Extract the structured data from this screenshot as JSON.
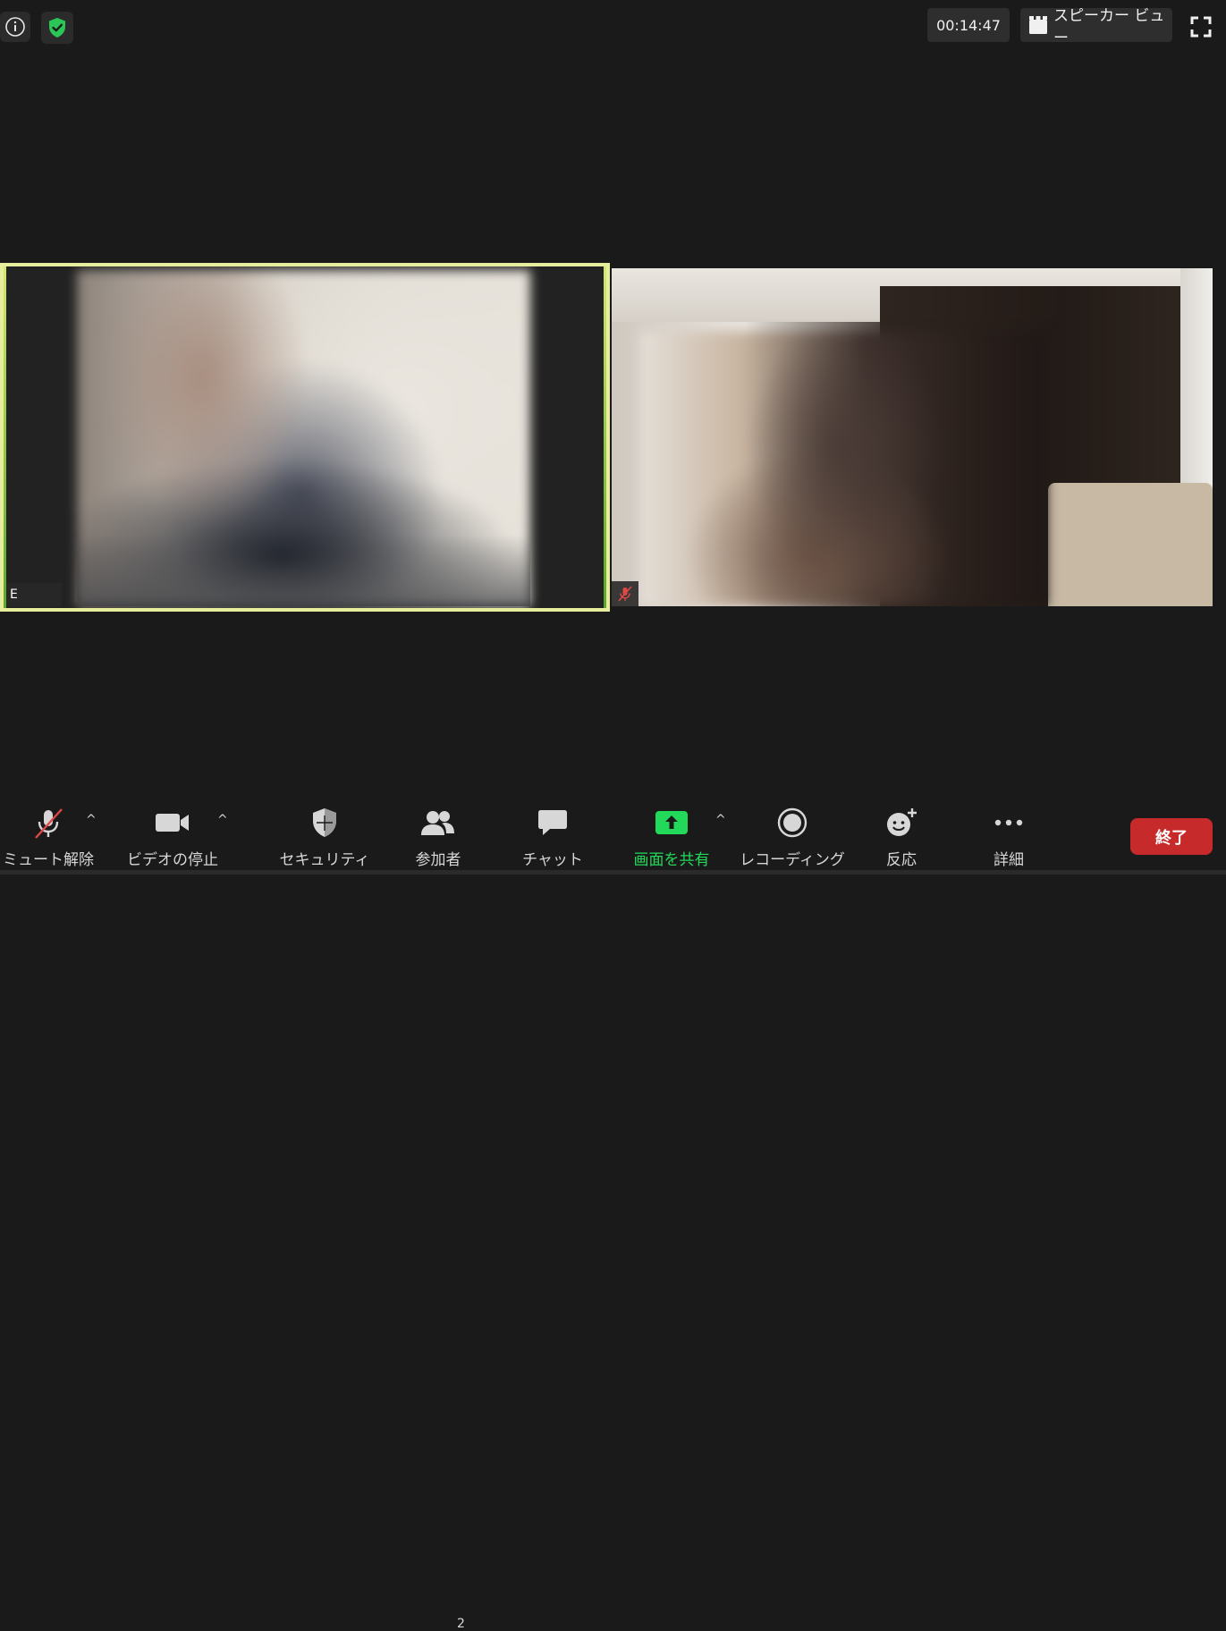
{
  "topbar": {
    "timer": "00:14:47",
    "view_label": "スピーカー ビュー"
  },
  "participants": {
    "left_tile": {
      "name_initial": "E",
      "active_speaker": true
    },
    "right_tile": {
      "muted": true
    }
  },
  "toolbar": {
    "mute_label": "ミュート解除",
    "video_label": "ビデオの停止",
    "security_label": "セキュリティ",
    "participants_label": "参加者",
    "participants_count": "2",
    "chat_label": "チャット",
    "share_label": "画面を共有",
    "record_label": "レコーディング",
    "reactions_label": "反応",
    "more_label": "詳細",
    "end_label": "終了"
  },
  "colors": {
    "share_accent": "#23d959",
    "end_button": "#c62a2a",
    "active_border": "#e6ee9e",
    "mute_red": "#e04848"
  }
}
